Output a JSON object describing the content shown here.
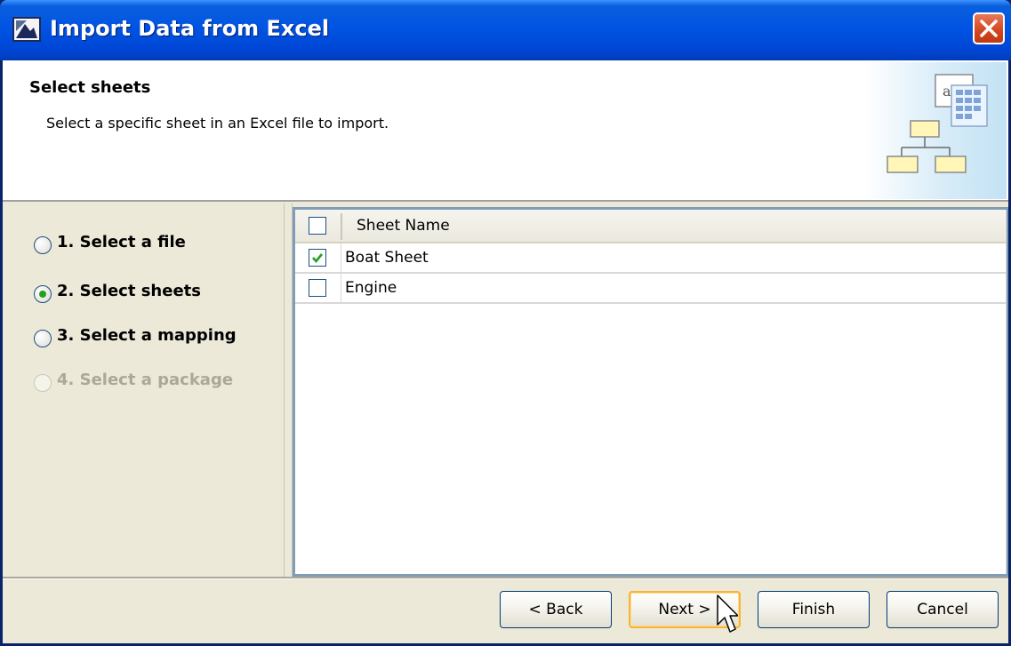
{
  "window": {
    "title": "Import Data from Excel"
  },
  "header": {
    "title": "Select sheets",
    "description": "Select a specific sheet in an Excel file to import.",
    "graphic_letter": "a."
  },
  "steps": [
    {
      "label": "1. Select a file",
      "selected": false,
      "enabled": true
    },
    {
      "label": "2. Select sheets",
      "selected": true,
      "enabled": true
    },
    {
      "label": "3. Select a mapping",
      "selected": false,
      "enabled": true
    },
    {
      "label": "4. Select a package",
      "selected": false,
      "enabled": false
    }
  ],
  "table": {
    "header": {
      "column": "Sheet Name",
      "select_all_checked": false
    },
    "rows": [
      {
        "name": "Boat Sheet",
        "checked": true
      },
      {
        "name": "Engine",
        "checked": false
      }
    ]
  },
  "buttons": {
    "back": "< Back",
    "next": "Next >",
    "finish": "Finish",
    "cancel": "Cancel"
  },
  "colors": {
    "title_bar": "#0054E3",
    "close_button": "#D4441E",
    "radio_selected": "#21A121",
    "check_mark": "#21A121",
    "default_button_border": "#F8B33B",
    "dialog_background": "#ECE9D8"
  }
}
